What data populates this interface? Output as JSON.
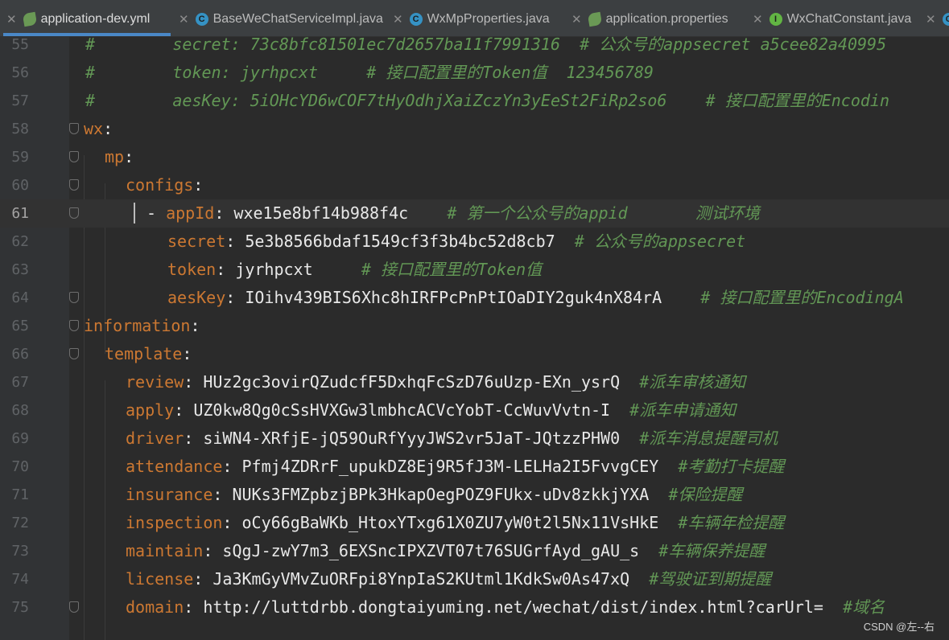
{
  "tabs": [
    {
      "label": "application-dev.yml",
      "icon": "leaf-config-icon",
      "active": true
    },
    {
      "label": "BaseWeChatServiceImpl.java",
      "icon": "class-icon"
    },
    {
      "label": "WxMpProperties.java",
      "icon": "class-icon"
    },
    {
      "label": "application.properties",
      "icon": "leaf-config-icon"
    },
    {
      "label": "WxChatConstant.java",
      "icon": "interface-icon"
    }
  ],
  "lines": [
    {
      "num": "55",
      "text": "#        secret: 73c8bfc81501ec7d2657ba11f7991316  # 公众号的appsecret a5cee82a40995"
    },
    {
      "num": "56",
      "text": "#        token: jyrhpcxt     # 接口配置里的Token值  123456789"
    },
    {
      "num": "57",
      "text": "#        aesKey: 5iOHcYD6wCOF7tHyOdhjXaiZczYn3yEeSt2FiRp2so6    # 接口配置里的Encodin"
    },
    {
      "num": "58",
      "key": "wx",
      "value": "",
      "comment": ""
    },
    {
      "num": "59",
      "key": "mp",
      "value": "",
      "comment": ""
    },
    {
      "num": "60",
      "key": "configs",
      "value": "",
      "comment": ""
    },
    {
      "num": "61",
      "dash": "- ",
      "key": "appId",
      "value": "wxe15e8bf14b988f4c",
      "comment": "# 第一个公众号的appid       测试环境"
    },
    {
      "num": "62",
      "key": "secret",
      "value": "5e3b8566bdaf1549cf3f3b4bc52d8cb7",
      "comment": "# 公众号的appsecret"
    },
    {
      "num": "63",
      "key": "token",
      "value": "jyrhpcxt",
      "comment": "# 接口配置里的Token值"
    },
    {
      "num": "64",
      "key": "aesKey",
      "value": "IOihv439BIS6Xhc8hIRFPcPnPtIOaDIY2guk4nX84rA",
      "comment": "# 接口配置里的EncodingA"
    },
    {
      "num": "65",
      "key": "information",
      "value": "",
      "comment": ""
    },
    {
      "num": "66",
      "key": "template",
      "value": "",
      "comment": ""
    },
    {
      "num": "67",
      "key": "review",
      "value": "HUz2gc3ovirQZudcfF5DxhqFcSzD76uUzp-EXn_ysrQ",
      "comment": "#派车审核通知"
    },
    {
      "num": "68",
      "key": "apply",
      "value": "UZ0kw8Qg0cSsHVXGw3lmbhcACVcYobT-CcWuvVvtn-I",
      "comment": "#派车申请通知"
    },
    {
      "num": "69",
      "key": "driver",
      "value": "siWN4-XRfjE-jQ59OuRfYyyJWS2vr5JaT-JQtzzPHW0",
      "comment": "#派车消息提醒司机"
    },
    {
      "num": "70",
      "key": "attendance",
      "value": "Pfmj4ZDRrF_upukDZ8Ej9R5fJ3M-LELHa2I5FvvgCEY",
      "comment": "#考勤打卡提醒"
    },
    {
      "num": "71",
      "key": "insurance",
      "value": "NUKs3FMZpbzjBPk3HkapOegPOZ9FUkx-uDv8zkkjYXA",
      "comment": "#保险提醒"
    },
    {
      "num": "72",
      "key": "inspection",
      "value": "oCy66gBaWKb_HtoxYTxg61X0ZU7yW0t2l5Nx11VsHkE",
      "comment": "#车辆年检提醒"
    },
    {
      "num": "73",
      "key": "maintain",
      "value": "sQgJ-zwY7m3_6EXSncIPXZVT07t76SUGrfAyd_gAU_s",
      "comment": "#车辆保养提醒"
    },
    {
      "num": "74",
      "key": "license",
      "value": "Ja3KmGyVMvZuORFpi8YnpIaS2KUtml1KdkSw0As47xQ",
      "comment": "#驾驶证到期提醒"
    },
    {
      "num": "75",
      "key": "domain",
      "value": "http://luttdrbb.dongtaiyuming.net/wechat/dist/index.html?carUrl=",
      "comment": "#域名"
    }
  ],
  "watermark": "CSDN @左--右",
  "colors": {
    "key": "#cc7832",
    "value": "#e8e8e8",
    "comment": "#629755",
    "background": "#2b2b2b",
    "tab_underline": "#4a88c7"
  }
}
